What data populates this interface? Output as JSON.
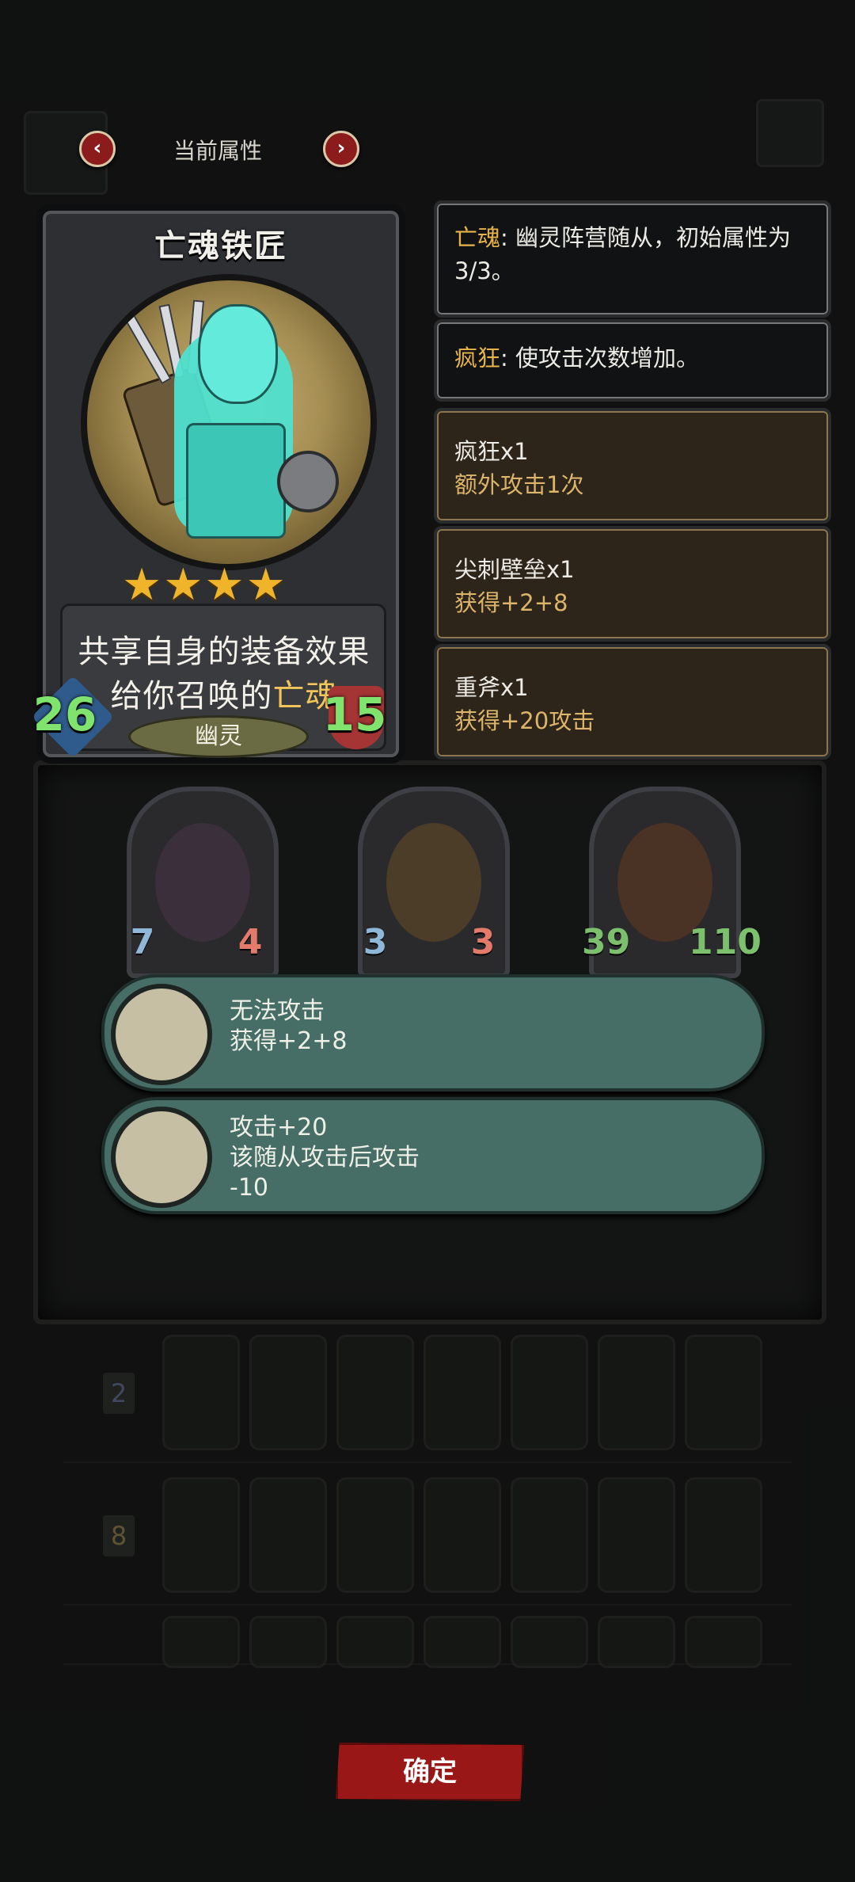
{
  "nav": {
    "title": "当前属性",
    "prev": "‹",
    "next": "›"
  },
  "card": {
    "name": "亡魂铁匠",
    "stars": "★★★★",
    "star_count": 4,
    "desc_part1": "共享自身的装备效果给你召唤的",
    "desc_highlight": "亡魂",
    "attack": "26",
    "health": "15",
    "tribe": "幽灵"
  },
  "keywords": [
    {
      "keyword": "亡魂",
      "text": ": 幽灵阵营随从，初始属性为3/3。"
    },
    {
      "keyword": "疯狂",
      "text": ": 使攻击次数增加。"
    }
  ],
  "buffs": [
    {
      "title": "疯狂x1",
      "sub": "额外攻击1次"
    },
    {
      "title": "尖刺壁垒x1",
      "sub": "获得+2+8"
    },
    {
      "title": "重斧x1",
      "sub": "获得+20攻击"
    }
  ],
  "minions": [
    {
      "atk": "7",
      "hp": "4"
    },
    {
      "atk": "3",
      "hp": "3"
    },
    {
      "atk": "39",
      "hp": "110"
    }
  ],
  "effects": [
    {
      "line1": "无法攻击",
      "line2": "获得+2+8",
      "line3": ""
    },
    {
      "line1": "攻击+20",
      "line2": "该随从攻击后攻击",
      "line3": "-10"
    }
  ],
  "deck_badges": [
    "2",
    "8"
  ],
  "confirm_label": "确定",
  "colors": {
    "accent_red": "#9a1717",
    "keyword_gold": "#e7b44c",
    "effect_green": "#466e66",
    "stat_green": "#7fe36e"
  }
}
